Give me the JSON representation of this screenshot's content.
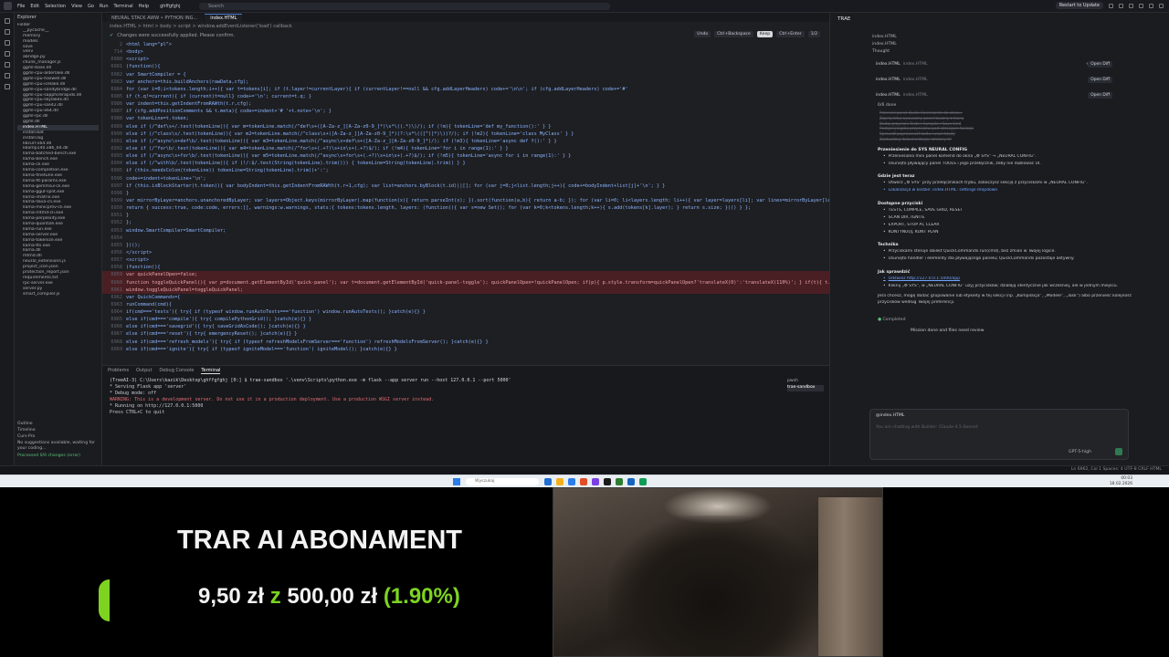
{
  "menubar": {
    "items": [
      "File",
      "Edit",
      "Selection",
      "View",
      "Go",
      "Run",
      "Terminal",
      "Help"
    ],
    "project": "ghffgfghj",
    "search_placeholder": "Search",
    "restart_label": "Restart to Update"
  },
  "explorer": {
    "title": "Explorer",
    "folder": "Folder",
    "items": [
      "__pycache__",
      "memory",
      "models",
      "save",
      "venv",
      "abridge.py",
      "chunk_manager.js",
      "ggml-base.dll",
      "ggml-cpu-alderlake.dll",
      "ggml-cpu-haswell.dll",
      "ggml-cpu-icelake.dll",
      "ggml-cpu-sandybridge.dll",
      "ggml-cpu-sapphirerapids.dll",
      "ggml-cpu-skylakex.dll",
      "ggml-cpu-sse42.dll",
      "ggml-cpu-x64.dll",
      "ggml-rpc.dll",
      "ggml.dll",
      "index.HTML",
      "install.bat",
      "install.log",
      "libcurl-x64.dll",
      "libomp140.x86_64.dll",
      "llama-batched-bench.exe",
      "llama-bench.exe",
      "llama-cli.exe",
      "llama-completion.exe",
      "llama-finetune.exe",
      "llama-fit-params.exe",
      "llama-gemma3-cli.exe",
      "llama-gguf-split.exe",
      "llama-imatrix.exe",
      "llama-llava-cli.exe",
      "llama-minicpmv-cli.exe",
      "llama-mtmd-cli.exe",
      "llama-perplexity.exe",
      "llama-quantize.exe",
      "llama-run.exe",
      "llama-server.exe",
      "llama-tokenize.exe",
      "llama-tts.exe",
      "llama.dll",
      "mtmd.dll",
      "neural_extensions.js",
      "project_icon.json",
      "protection_report.json",
      "requirements.txt",
      "rpc-server.exe",
      "server.py",
      "smart_compiler.js"
    ],
    "selected_index": 18,
    "outline": "Outline",
    "timeline": "Timeline",
    "cursor_label": "Curs-Pro",
    "no_suggestions": "No suggestions available, waiting for your coding...",
    "processed": "Processed 0/0 changes (error)"
  },
  "editor": {
    "tabs": [
      "NEURAL STACK AWW • PYTHON ING...",
      "index.HTML"
    ],
    "active_tab": 1,
    "breadcrumb": "index.HTML  >  html  >  body  >  script  >  window.addEventListener('load') callback",
    "notice": "Changes were successfully applied. Please confirm.",
    "undo": "Undo",
    "ctrl_backspace": "Ctrl+Backspace",
    "keep": "Keep",
    "ctrl_enter": "Ctrl+Enter",
    "page": "1/2",
    "lines": [
      {
        "n": "2",
        "t": "<html lang=\"pl\">",
        "red": false
      },
      {
        "n": "714",
        "t": "<body>",
        "red": false
      },
      {
        "n": "6980",
        "t": "<script>",
        "red": false
      },
      {
        "n": "6981",
        "t": "(function(){",
        "red": false
      },
      {
        "n": "6982",
        "t": "var SmartCompiler = {",
        "red": false
      },
      {
        "n": "6983",
        "t": "  var anchors=this.buildAnchors(rawData,cfg);",
        "red": false
      },
      {
        "n": "6984",
        "t": "  for (var i=0;i<tokens.length;i++){ var t=tokens[i]; if (t.layer!=currentLayer){ if (currentLayer!==null && cfg.addLayerHeaders) code+='\\n\\n'; if (cfg.addLayerHeaders) code+='#'",
        "red": false
      },
      {
        "n": "6985",
        "t": "  if (t.q!=current){ if (current)t=null} code+='\\n'; current=t.q; }",
        "red": false
      },
      {
        "n": "6986",
        "t": "  var indent=this.getIndentFromRAWth(t.r,cfg);",
        "red": false
      },
      {
        "n": "6987",
        "t": "  if (cfg.addPositionComments && t.meta){ code+=indent+'# '+t.note+'\\n'; }",
        "red": false
      },
      {
        "n": "6988",
        "t": "  var tokenLine=t.token;",
        "red": false
      },
      {
        "n": "6989",
        "t": "  else if (/^def\\s+/.test(tokenLine)){ var m=tokenLine.match(/^def\\s+([A-Za-z_][A-Za-z0-9_]*)\\s*\\((.*)\\)/); if (!m){ tokenLine='def my_function():' } }",
        "red": false
      },
      {
        "n": "6990",
        "t": "  else if (/^class\\s/.test(tokenLine)){ var m2=tokenLine.match(/^class\\s+([A-Za-z_][A-Za-z0-9_]*)(?:\\s*\\(([^)]*)\\))?/); if (!m2){ tokenLine='class MyClass' } }",
        "red": false
      },
      {
        "n": "6991",
        "t": "  else if (/^async\\s+def\\b/.test(tokenLine)){ var m3=tokenLine.match(/^async\\s+def\\s+([A-Za-z_][A-Za-z0-9_]*)/); if (!m3){ tokenLine='async def f():' } }",
        "red": false
      },
      {
        "n": "6992",
        "t": "  else if (/^for\\b/.test(tokenLine)){ var m4=tokenLine.match(/^for\\s+(.+?)\\s+in\\s+(.+?)$/); if (!m4){ tokenLine='for i in range(1):' } }",
        "red": false
      },
      {
        "n": "6993",
        "t": "  else if (/^async\\s+for\\b/.test(tokenLine)){ var m5=tokenLine.match(/^async\\s+for\\s+(.+?)\\s+in\\s+(.+?)$/); if (!m5){ tokenLine='async for i in range(1):' } }",
        "red": false
      },
      {
        "n": "6994",
        "t": "  else if (/^with\\b/.test(tokenLine)){ if (!/:$/.test(String(tokenLine).trim())) { tokenLine=String(tokenLine).trim() } }",
        "red": false
      },
      {
        "n": "6995",
        "t": "  if (this.needsColon(tokenLine)) tokenLine=String(tokenLine).trim()+':';",
        "red": false
      },
      {
        "n": "6996",
        "t": "  code+=indent+tokenLine+'\\n';",
        "red": false
      },
      {
        "n": "6997",
        "t": "  if (this.isBlockStarter(t.token)){ var bodyIndent=this.getIndentFromRAWth(t.r+1,cfg); var list=anchors.byBlock(t.id)||[]; for (var j=0;j<list.length;j++){ code+=bodyIndent+list[j]+'\\n'; } }",
        "red": false
      },
      {
        "n": "6998",
        "t": "}",
        "red": false
      },
      {
        "n": "6999",
        "t": "  var mirrorByLayer=anchors.unanchoredByLayer; var layers=Object.keys(mirrorByLayer).map(function(x){ return parseInt(x); }).sort(function(a,b){ return a-b; }); for (var li=0; li<layers.length; li++){ var layer=layers[li]; var lines=mirrorByLayer[layer]; if (lines &&",
        "red": false
      },
      {
        "n": "6950",
        "t": "  return { success:true, code:code, errors:[], warnings:w.warnings, stats:{ tokens:tokens.length, layers: (function(){ var s=new Set(); for (var k=0;k<tokens.length;k++){ s.add(tokens[k].layer); } return s.size; })() } };",
        "red": false
      },
      {
        "n": "6951",
        "t": "}",
        "red": false
      },
      {
        "n": "6952",
        "t": "};",
        "red": false
      },
      {
        "n": "6953",
        "t": "window.SmartCompiler=SmartCompiler;",
        "red": false
      },
      {
        "n": "6954",
        "t": "",
        "red": false
      },
      {
        "n": "6955",
        "t": "})();",
        "red": false
      },
      {
        "n": "6956",
        "t": "</script>",
        "red": false
      },
      {
        "n": "6957",
        "t": "<script>",
        "red": false
      },
      {
        "n": "6958",
        "t": "(function(){",
        "red": false
      },
      {
        "n": "6959",
        "t": "var quickPanelOpen=false;",
        "red": true
      },
      {
        "n": "6960",
        "t": "function toggleQuickPanel(){ var p=document.getElementById('quick-panel'); var t=document.getElementById('quick-panel-toggle'); quickPanelOpen=!quickPanelOpen; if(p){ p.style.transform=quickPanelOpen?'translateX(0)':'translateX(110%)'; } if(t){ t.textContent=quic",
        "red": true
      },
      {
        "n": "6961",
        "t": "window.toggleQuickPanel=toggleQuickPanel;",
        "red": true
      },
      {
        "n": "6962",
        "t": "var QuickCommands={",
        "red": false
      },
      {
        "n": "6963",
        "t": "  runCommand(cmd){",
        "red": false
      },
      {
        "n": "6964",
        "t": "    if(cmd==='tests'){ try{ if (typeof window.runAutoTests==='function') window.runAutoTests(); }catch(e){} }",
        "red": false
      },
      {
        "n": "6965",
        "t": "    else if(cmd==='compile'){ try{ compilePythonGrid(); }catch(e){} }",
        "red": false
      },
      {
        "n": "6966",
        "t": "    else if(cmd==='savegrid'){ try{ saveGridAsCode(); }catch(e){} }",
        "red": false
      },
      {
        "n": "6967",
        "t": "    else if(cmd==='reset'){ try{ emergencyReset(); }catch(e){} }",
        "red": false
      },
      {
        "n": "6968",
        "t": "    else if(cmd==='refresh_models'){ try{ if (typeof refreshModelsFromServer==='function') refreshModelsFromServer(); }catch(e){} }",
        "red": false
      },
      {
        "n": "6969",
        "t": "    else if(cmd==='ignite'){ try{ if (typeof igniteModel==='function') igniteModel(); }catch(e){} }",
        "red": false
      }
    ]
  },
  "panel": {
    "tabs": [
      "Problems",
      "Output",
      "Debug Console",
      "Terminal"
    ],
    "active_tab": 3,
    "terminal_lines": [
      "(TreeAI-3) C:\\Users\\kazik\\Desktop\\ghffgfghj [0:] $ trae-sandbox '.\\venv\\Scripts\\python.exe -m flask --app server run --host 127.0.0.1 --port 5000'",
      " * Serving Flask app 'server'",
      " * Debug mode: off",
      "WARNING: This is a development server. Do not use it in a production deployment. Use a production WSGI server instead.",
      " * Running on http://127.0.0.1:5000",
      "Press CTRL+C to quit"
    ],
    "terminals": [
      "pwsh",
      "trae-sandbox"
    ]
  },
  "chat": {
    "title": "TRAE",
    "file_label": "index.HTML",
    "thought": "Thought",
    "files": [
      {
        "name": "index.HTML",
        "path": "index.HTML",
        "plus": "+13",
        "minus": "-11",
        "open": "Open Diff"
      },
      {
        "name": "index.HTML",
        "path": "index.HTML",
        "plus": "+0",
        "minus": "-1",
        "open": "Open Diff"
      },
      {
        "name": "index.HTML",
        "path": "index.HTML",
        "plus": "+0",
        "minus": "-1",
        "open": "Open Diff"
      }
    ],
    "done": "6/6 done",
    "done_items": [
      "Przenieś panel Quick Commands do okna...",
      "Zaprojektuj wysuwany panel boczny z ikoną",
      "Dodaj przyciski Tests / Compile / Save Grid",
      "Podepnij logikę przycisków pod istniejące funkcje",
      "Sprawdź poprawność kodu i usuń błędy",
      "Zaktualizuj dokumentację i zmiany UI"
    ],
    "section1": "Przeniesienie do SYS NEURAL CONFIG",
    "s1_bullets": [
      "Przeniesiono mini panel komend do okna „⚙ SYS” → „NEURAL CONFIG”.",
      "Usunięto pływający panel TOOLS i jego przełącznik, żeby nie dublować UI."
    ],
    "section2": "Gdzie jest teraz",
    "s2_bullets": [
      "Otwórz „⚙ SYS” przy przełącznikach trybu, zobaczysz sekcję z przyciskami w „NEURAL CONFIG”.",
      "Lokalizacja w kodzie: index.HTML: settings-dropdown"
    ],
    "section3": "Dostępne przyciski",
    "s3_bullets": [
      "TESTS, COMPILE, SAVE GRID, RESET",
      "SCAN DIR, IGNITE",
      "EXPORT, STOP AI, CLEAR",
      "KONTYNUUJ, KONT PLAN"
    ],
    "section4": "Technika",
    "s4_bullets": [
      "Przyciskami steruje obiekt QuickCommands.run(cmd), bez zmian w Twojej logice.",
      "Usunięto handler i elementy dla pływającego panelu; QuickCommands pozostaje aktywny."
    ],
    "section5": "Jak sprawdzić",
    "s5_bullets": [
      "Odśwież http://127.0.0.1:5000/app",
      "Kliknij „⚙ SYS”, w „NEURAL CONFIG” użyj przycisków; działają identycznie jak wcześniej, ale w jednym miejscu."
    ],
    "closing": [
      "Jeśli chcesz, mogę dodać grupowanie lub etykiety w tej sekcji (np. „Kompilacja”, „Modele”, „Task”) albo przenieść kolejność",
      "przycisków według Twojej preferencji."
    ],
    "completed": "Completed",
    "mission": "Mission done and files need review",
    "input_file": "@index.HTML",
    "input_placeholder": "You are chatting with Builder: Claude-4.5-Sonnet",
    "model": "GPT-5-high"
  },
  "statusbar": {
    "right": "Ln 6962, Col 1   Spaces: 4   UTF-8   CRLF   HTML"
  },
  "taskbar": {
    "search": "Wyszukaj",
    "clock_time": "00:03",
    "clock_date": "18.02.2026",
    "icon_colors": [
      "#1f6fd1",
      "#f2b01e",
      "#2b7de9",
      "#e44d26",
      "#7b3fe4",
      "#1b1b1b",
      "#2e7d32",
      "#1565c0",
      "#0f9d58"
    ]
  },
  "overlay": {
    "title": "TRAR AI ABONAMENT",
    "current": "9,50 zł",
    "of": "z",
    "target": "500,00 zł",
    "percent": "(1.90%)",
    "progress_fraction": 0.019,
    "accent": "#7ed321"
  }
}
